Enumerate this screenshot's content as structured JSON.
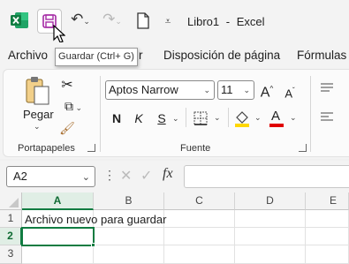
{
  "title_bar": {
    "document_title": "Libro1",
    "separator": "-",
    "app_name": "Excel",
    "accent_color": "#107c41",
    "save_icon_color": "#a52aa5"
  },
  "tooltip": {
    "text": "Guardar (Ctrl+ G)"
  },
  "menu": {
    "items": [
      "Archivo",
      "r",
      "Disposición de página",
      "Fórmulas"
    ]
  },
  "ribbon": {
    "clipboard": {
      "paste_label": "Pegar",
      "group_label": "Portapapeles"
    },
    "font": {
      "font_name": "Aptos Narrow",
      "font_size": "11",
      "bold": "N",
      "italic": "K",
      "underline": "S",
      "grow": "A",
      "shrink": "A",
      "font_color_letter": "A",
      "group_label": "Fuente",
      "highlight_color": "#ffd700",
      "font_color": "#e00000"
    }
  },
  "formula_bar": {
    "name_box": "A2",
    "formula_value": ""
  },
  "sheet": {
    "columns": [
      "A",
      "B",
      "C",
      "D",
      "E"
    ],
    "rows": [
      "1",
      "2",
      "3"
    ],
    "cell_A1": "Archivo nuevo para guardar",
    "active_cell": "A2"
  }
}
